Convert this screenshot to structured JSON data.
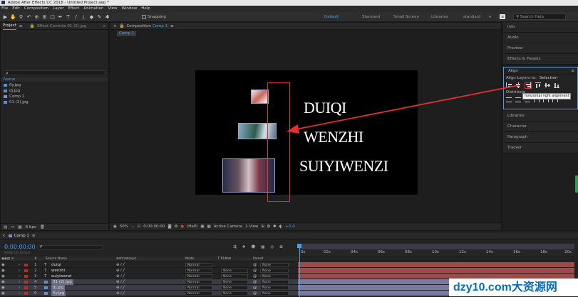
{
  "app": {
    "title": "Adobe After Effects CC 2018 - Untitled Project.aep *"
  },
  "menu": [
    "File",
    "Edit",
    "Composition",
    "Layer",
    "Effect",
    "Animation",
    "View",
    "Window",
    "Help"
  ],
  "toolbar": {
    "snapping": "Snapping",
    "workspaces": [
      "Default",
      "Standard",
      "Small Screen",
      "Libraries",
      "standard"
    ],
    "active_workspace": "Default",
    "search_placeholder": "Search Help"
  },
  "project": {
    "tab_project": "Project",
    "tab_effects": "Effect Controls 01 (2).jpg",
    "search_placeholder": "ρ",
    "col_name": "Name",
    "items": [
      "fly.jpg",
      "dj.jpg",
      "Comp 1",
      "01 (2).jpg"
    ],
    "footer_bpc": "8 bpc"
  },
  "composition": {
    "tab_label": "Composition",
    "tab_name": "Comp 1",
    "breadcrumb": "Comp 1",
    "texts": [
      "DUIQI",
      "WENZHI",
      "SUIYIWENZI"
    ]
  },
  "viewer_footer": {
    "zoom": "50%",
    "timecode": "0:00:00:00",
    "resolution": "(Half)",
    "camera": "Active Camera",
    "views": "1 View",
    "offset": "+0.0"
  },
  "right_panels": {
    "top": [
      "Info",
      "Audio",
      "Preview",
      "Effects & Presets"
    ],
    "align": {
      "title": "Align",
      "align_layers_label": "Align Layers to:",
      "align_target": "Selection",
      "distribute_label": "Distribute",
      "tooltip": "horizontal right alignment"
    },
    "bottom": [
      "Libraries",
      "Character",
      "Paragraph",
      "Tracker"
    ]
  },
  "timeline": {
    "tab": "Comp 1",
    "timecode": "0:00:00:00",
    "fps": "00000 (25.00 fps)",
    "col_num": "#",
    "col_source": "Source Name",
    "col_mode": "Mode",
    "col_trkmat": "T TrkMat",
    "col_parent": "Parent",
    "layers": [
      {
        "num": "1",
        "type": "T",
        "name": "duiqi",
        "mode": "Normal",
        "trkmat": "",
        "parent": "None"
      },
      {
        "num": "2",
        "type": "T",
        "name": "wenzhi",
        "mode": "Normal",
        "trkmat": "None",
        "parent": "None"
      },
      {
        "num": "3",
        "type": "T",
        "name": "suiyiwenzi",
        "mode": "Normal",
        "trkmat": "None",
        "parent": "None"
      },
      {
        "num": "4",
        "type": "img",
        "name": "01 (2).jpg",
        "mode": "Normal",
        "trkmat": "None",
        "parent": "None"
      },
      {
        "num": "5",
        "type": "img",
        "name": "dj.jpg",
        "mode": "Normal",
        "trkmat": "None",
        "parent": "None"
      },
      {
        "num": "6",
        "type": "img",
        "name": "fly.jpg",
        "mode": "Normal",
        "trkmat": "None",
        "parent": "None"
      }
    ],
    "ruler": [
      "0s",
      "02s",
      "04s",
      "06s",
      "08s",
      "10s",
      "12s",
      "14s",
      "16s",
      "18s",
      "20s"
    ]
  },
  "watermark": "dzy10.com大资源网",
  "colors": {
    "accent": "#4a9cf0",
    "annotation": "#e03030",
    "comp_bg": "#000000"
  }
}
